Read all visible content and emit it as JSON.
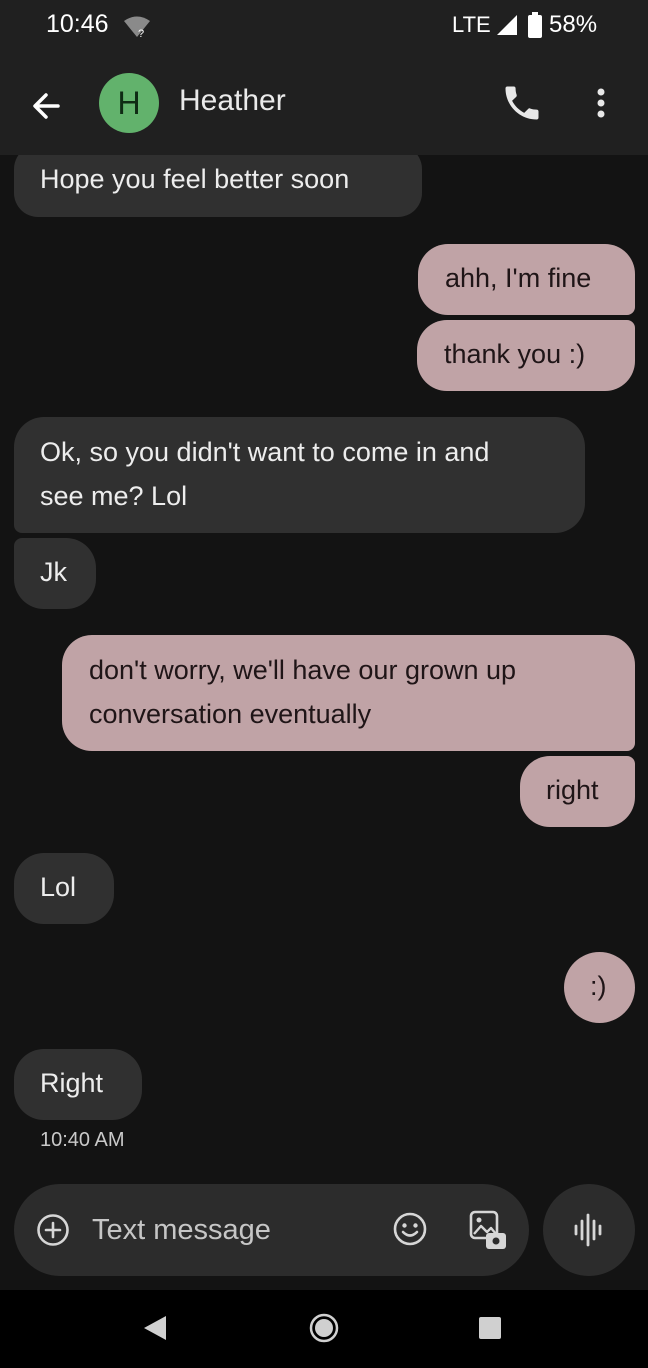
{
  "status_bar": {
    "time": "10:46",
    "wifi_badge": "?",
    "network": "LTE",
    "battery": "58%"
  },
  "app_bar": {
    "avatar_letter": "H",
    "contact_name": "Heather",
    "icons": [
      "back-arrow-icon",
      "phone-icon",
      "more-vert-icon"
    ]
  },
  "conversation": {
    "messages": [
      {
        "dir": "in",
        "lines": [
          "Hope you feel better soon"
        ]
      },
      {
        "dir": "out",
        "lines": [
          "ahh, I'm fine"
        ]
      },
      {
        "dir": "out",
        "lines": [
          "thank you  :)"
        ]
      },
      {
        "dir": "in",
        "lines": [
          "Ok, so you didn't want to come in and",
          "see me? Lol"
        ]
      },
      {
        "dir": "in",
        "lines": [
          "Jk"
        ]
      },
      {
        "dir": "out",
        "lines": [
          "don't worry, we'll have our grown up",
          "conversation eventually"
        ]
      },
      {
        "dir": "out",
        "lines": [
          "right"
        ]
      },
      {
        "dir": "in",
        "lines": [
          "Lol"
        ]
      },
      {
        "dir": "out",
        "lines": [
          ":)"
        ]
      },
      {
        "dir": "in",
        "lines": [
          "Right"
        ]
      }
    ],
    "timestamp": "10:40 AM"
  },
  "composer": {
    "placeholder": "Text message",
    "icons": [
      "add-icon",
      "emoji-icon",
      "gallery-icon",
      "voice-icon"
    ]
  },
  "colors": {
    "background": "#131313",
    "bar": "#202020",
    "incoming_bubble": "#303030",
    "outgoing_bubble": "#c0a3a6",
    "avatar": "#62b26c"
  }
}
